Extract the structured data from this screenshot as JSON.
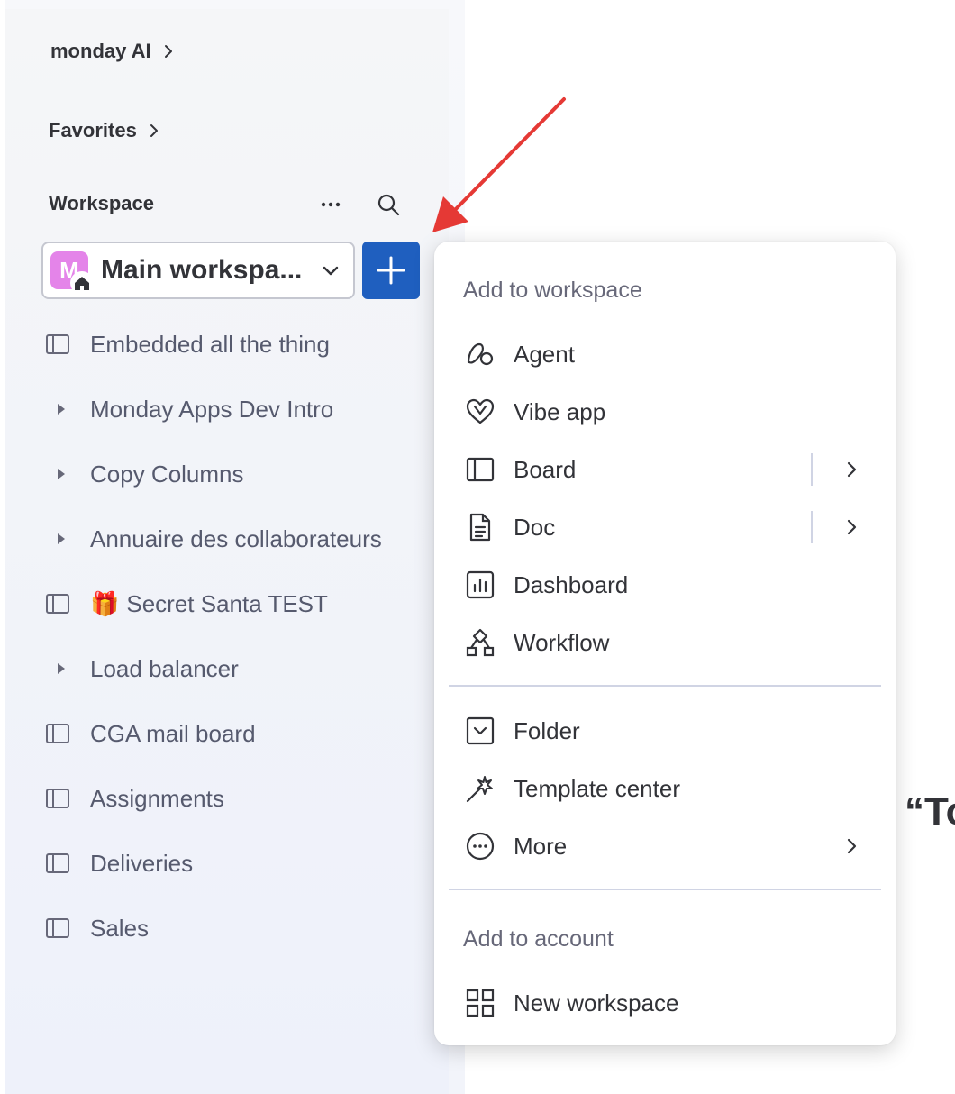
{
  "sidebar": {
    "monday_ai": "monday AI",
    "favorites": "Favorites",
    "workspace_label": "Workspace",
    "workspace_selector": {
      "avatar_letter": "M",
      "name": "Main workspa..."
    },
    "items": [
      {
        "label": "Embedded all the thing",
        "icon": "board-icon"
      },
      {
        "label": "Monday Apps Dev Intro",
        "icon": "caret-right-icon"
      },
      {
        "label": "Copy Columns",
        "icon": "caret-right-icon"
      },
      {
        "label": "Annuaire des collaborateurs",
        "icon": "caret-right-icon"
      },
      {
        "label": "Secret Santa TEST",
        "icon": "board-icon",
        "emoji": "🎁"
      },
      {
        "label": "Load balancer",
        "icon": "caret-right-icon"
      },
      {
        "label": "CGA mail board",
        "icon": "board-icon"
      },
      {
        "label": "Assignments",
        "icon": "board-icon"
      },
      {
        "label": "Deliveries",
        "icon": "board-icon"
      },
      {
        "label": "Sales",
        "icon": "board-icon"
      }
    ]
  },
  "menu": {
    "section_workspace": "Add to workspace",
    "workspace_items": [
      {
        "label": "Agent",
        "icon": "agent-icon"
      },
      {
        "label": "Vibe app",
        "icon": "vibe-heart-icon"
      },
      {
        "label": "Board",
        "icon": "board-icon",
        "has_submenu": true
      },
      {
        "label": "Doc",
        "icon": "doc-icon",
        "has_submenu": true
      },
      {
        "label": "Dashboard",
        "icon": "dashboard-icon"
      },
      {
        "label": "Workflow",
        "icon": "workflow-icon"
      }
    ],
    "other_items": [
      {
        "label": "Folder",
        "icon": "folder-icon"
      },
      {
        "label": "Template center",
        "icon": "magic-wand-icon"
      },
      {
        "label": "More",
        "icon": "more-circle-icon",
        "has_submenu": true
      }
    ],
    "section_account": "Add to account",
    "account_items": [
      {
        "label": "New workspace",
        "icon": "grid-icon"
      }
    ]
  },
  "background": {
    "quote_peek": "“To"
  },
  "colors": {
    "primary": "#1f5fbf",
    "avatar": "#e484e9",
    "annotation_arrow": "#e53935"
  }
}
